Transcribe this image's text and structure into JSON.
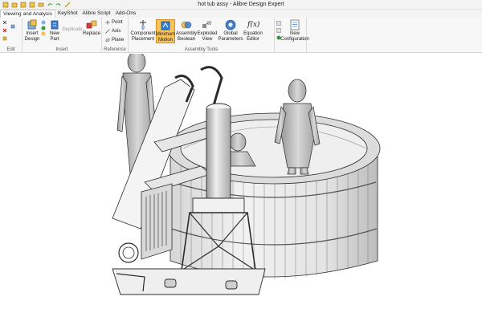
{
  "window": {
    "title": "hot tub assy - Alibre Design Expert"
  },
  "menu": {
    "items": [
      "Viewing and Analysis",
      "KeyShot",
      "Alibre Script",
      "Add-Ons"
    ]
  },
  "ribbon": {
    "groups": {
      "edit": "Edit",
      "insert": "Insert",
      "reference": "Reference",
      "assembly_tools": "Assembly Tools"
    },
    "buttons": {
      "insert_design": "Insert Design",
      "new_part": "New Part",
      "duplicate": "Duplicate",
      "replace": "Replace",
      "point": "Point",
      "axis": "Axis",
      "plane": "Plane",
      "component_placement": "Component Placement",
      "minimum_motion": "Minimum Motion",
      "assembly_boolean": "Assembly Boolean",
      "exploded_view": "Exploded View",
      "global_parameters": "Global Parameters",
      "equation_editor": "Equation Editor",
      "new_configuration": "New Configuration"
    },
    "equation_icon_text": "f(x)",
    "selected_button": "Minimum Motion",
    "accent_color": "#f7c35a"
  },
  "viewport": {
    "model": "hot tub assy",
    "colors": {
      "background": "#ffffff",
      "part_fill": "#e8e8e8",
      "part_shade": "#b9b9b9",
      "edge": "#2b2b2b"
    }
  }
}
